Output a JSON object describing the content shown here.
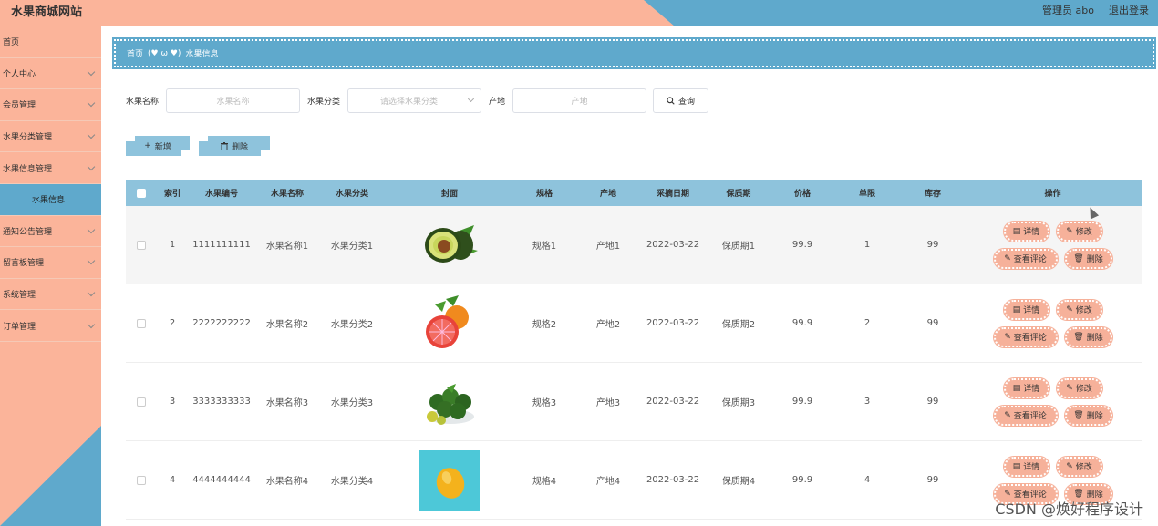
{
  "header": {
    "site_title": "水果商城网站",
    "admin_label": "管理员 abo",
    "logout_label": "退出登录"
  },
  "sidebar": {
    "items": [
      {
        "label": "首页"
      },
      {
        "label": "个人中心"
      },
      {
        "label": "会员管理"
      },
      {
        "label": "水果分类管理"
      },
      {
        "label": "水果信息管理"
      },
      {
        "label": "水果信息"
      },
      {
        "label": "通知公告管理"
      },
      {
        "label": "留言板管理"
      },
      {
        "label": "系统管理"
      },
      {
        "label": "订单管理"
      }
    ]
  },
  "breadcrumb": {
    "home": "首页",
    "current": "水果信息"
  },
  "search": {
    "name_label": "水果名称",
    "name_placeholder": "水果名称",
    "category_label": "水果分类",
    "category_placeholder": "请选择水果分类",
    "origin_label": "产地",
    "origin_placeholder": "产地",
    "query_button": "查询"
  },
  "actions": {
    "add_button": "新增",
    "delete_button": "删除"
  },
  "table": {
    "headers": {
      "index": "索引",
      "code": "水果编号",
      "name": "水果名称",
      "category": "水果分类",
      "cover": "封面",
      "spec": "规格",
      "origin": "产地",
      "pick_date": "采摘日期",
      "shelf_life": "保质期",
      "price": "价格",
      "limit": "单限",
      "stock": "库存",
      "ops": "操作"
    },
    "ops_labels": {
      "detail": "详情",
      "edit": "修改",
      "comments": "查看评论",
      "delete": "删除"
    },
    "rows": [
      {
        "index": "1",
        "code": "1111111111",
        "name": "水果名称1",
        "category": "水果分类1",
        "spec": "规格1",
        "origin": "产地1",
        "pick_date": "2022-03-22",
        "shelf_life": "保质期1",
        "price": "99.9",
        "limit": "1",
        "stock": "99"
      },
      {
        "index": "2",
        "code": "2222222222",
        "name": "水果名称2",
        "category": "水果分类2",
        "spec": "规格2",
        "origin": "产地2",
        "pick_date": "2022-03-22",
        "shelf_life": "保质期2",
        "price": "99.9",
        "limit": "2",
        "stock": "99"
      },
      {
        "index": "3",
        "code": "3333333333",
        "name": "水果名称3",
        "category": "水果分类3",
        "spec": "规格3",
        "origin": "产地3",
        "pick_date": "2022-03-22",
        "shelf_life": "保质期3",
        "price": "99.9",
        "limit": "3",
        "stock": "99"
      },
      {
        "index": "4",
        "code": "4444444444",
        "name": "水果名称4",
        "category": "水果分类4",
        "spec": "规格4",
        "origin": "产地4",
        "pick_date": "2022-03-22",
        "shelf_life": "保质期4",
        "price": "99.9",
        "limit": "4",
        "stock": "99"
      }
    ]
  },
  "watermark": "CSDN @焕好程序设计",
  "colors": {
    "salmon": "#fbb49a",
    "blue": "#5fa9cc",
    "light_blue": "#8ec3dc",
    "op_button": "#f6b19a"
  }
}
